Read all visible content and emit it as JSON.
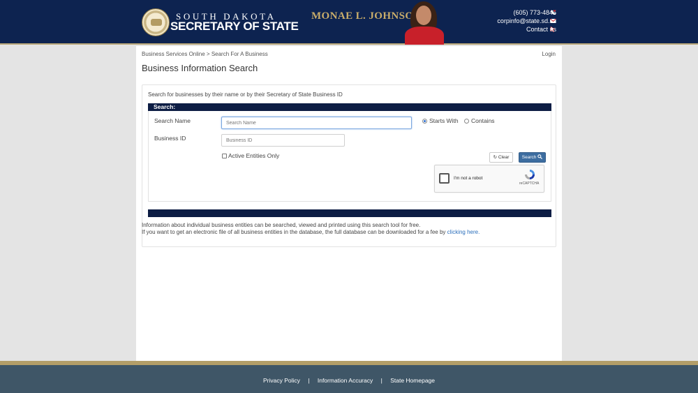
{
  "header": {
    "logo_top": "SOUTH DAKOTA",
    "logo_bottom": "SECRETARY OF STATE",
    "officer_name": "MONAE L. JOHNSON",
    "contacts": [
      {
        "label": "(605) 773-4845",
        "icon": "phone-icon"
      },
      {
        "label": "corpinfo@state.sd.us",
        "icon": "envelope-icon"
      },
      {
        "label": "Contact us",
        "icon": "cursor-icon"
      }
    ]
  },
  "breadcrumb": "Business Services Online > Search For A Business",
  "login_label": "Login",
  "page_title": "Business Information Search",
  "card": {
    "intro": "Search for businesses by their name or by their Secretary of State Business ID",
    "section_title": "Search:",
    "search_name_label": "Search Name",
    "search_name_placeholder": "Search Name",
    "business_id_label": "Business ID",
    "business_id_placeholder": "Business ID",
    "match_options": [
      {
        "label": "Starts With",
        "selected": true
      },
      {
        "label": "Contains",
        "selected": false
      }
    ],
    "active_only_label": "Active Entities Only",
    "active_only_checked": false,
    "clear_button": "Clear",
    "search_button": "Search",
    "recaptcha": {
      "label": "I'm not a robot",
      "brand": "reCAPTCHA"
    },
    "info_line1": "Information about individual business entities can be searched, viewed and printed using this search tool for free.",
    "info_line2_prefix": "If you want to get an electronic file of all business entities in the database, the full database can be downloaded for a fee by",
    "info_link": "clicking here."
  },
  "footer": {
    "links": [
      "Privacy Policy",
      "Information Accuracy",
      "State Homepage"
    ],
    "separator": "|"
  },
  "colors": {
    "header_bg": "#0d2350",
    "section_bar": "#0d1d44",
    "search_button": "#3d6da0",
    "footer_bg": "#3f5667",
    "accent_gold": "#b39e68",
    "link": "#2a6ebb"
  }
}
